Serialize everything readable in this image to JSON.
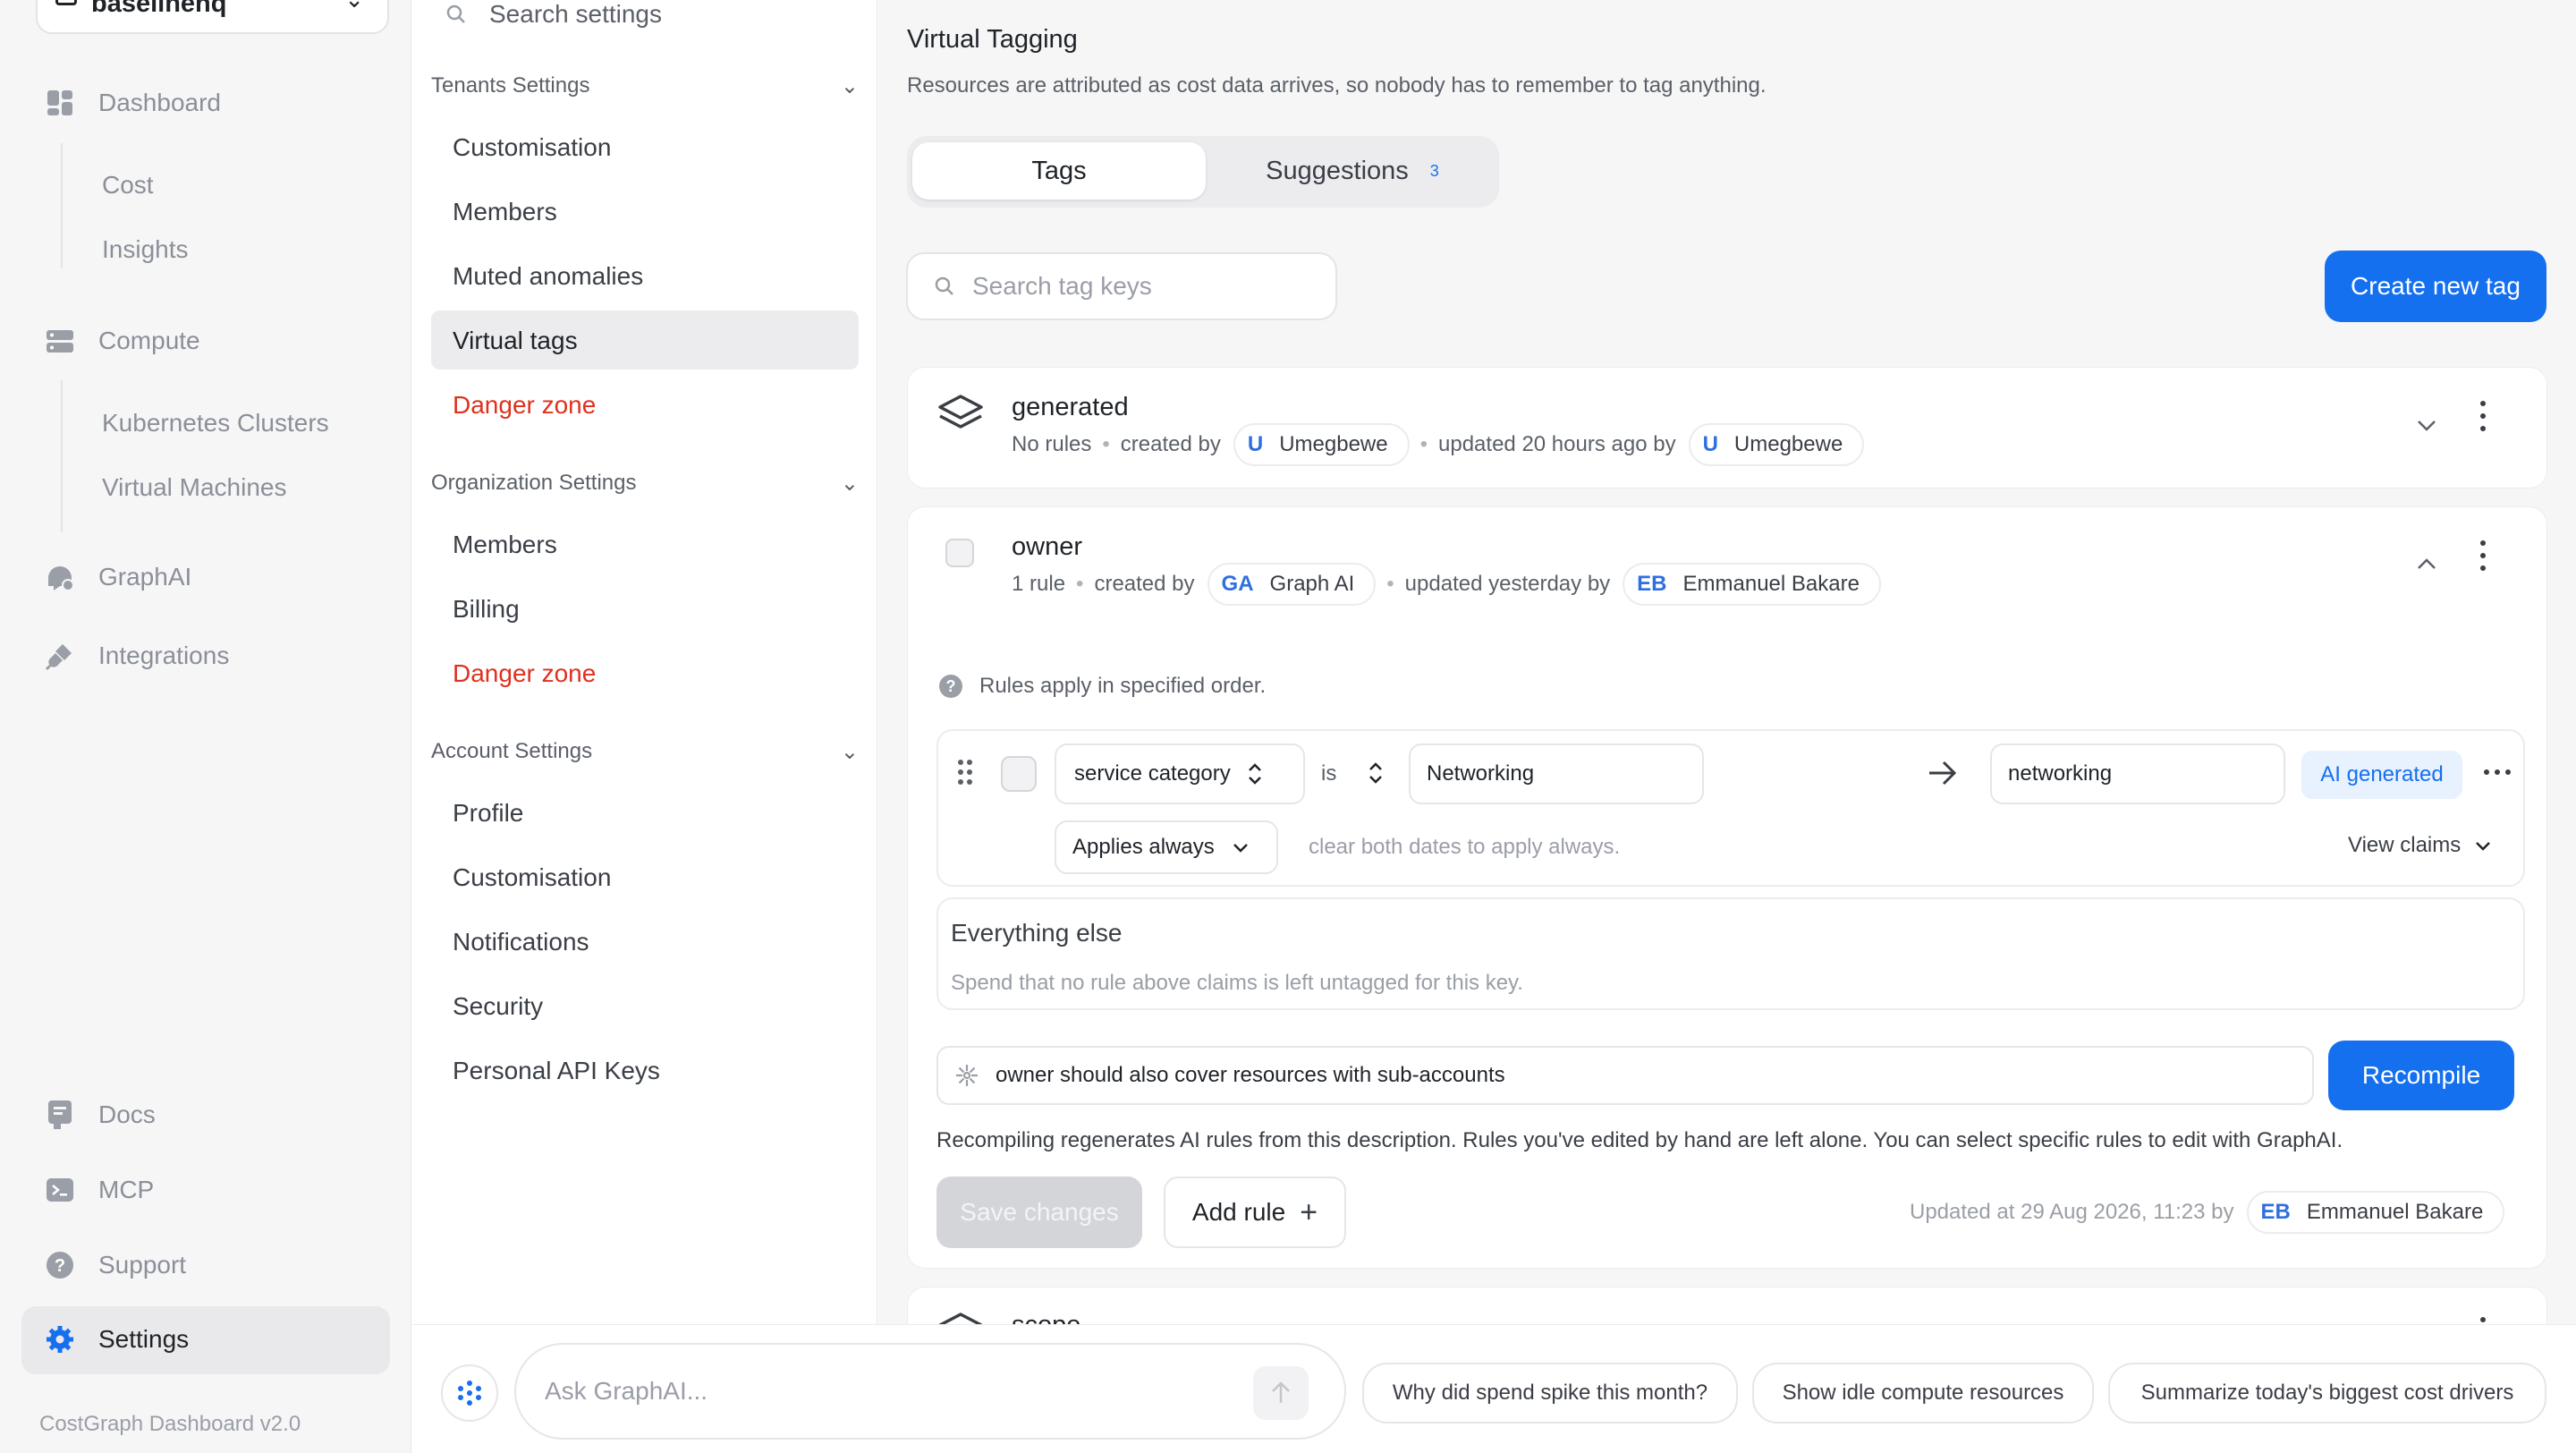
{
  "tenant": {
    "name": "baselinehq"
  },
  "nav": {
    "dashboard": "Dashboard",
    "cost": "Cost",
    "insights": "Insights",
    "compute": "Compute",
    "k8s": "Kubernetes Clusters",
    "vms": "Virtual Machines",
    "graphai": "GraphAI",
    "integrations": "Integrations",
    "docs": "Docs",
    "mcp": "MCP",
    "support": "Support",
    "settings": "Settings",
    "version": "CostGraph Dashboard v2.0"
  },
  "settings_nav": {
    "search_placeholder": "Search settings",
    "tenants_title": "Tenants Settings",
    "tenants_items": [
      "Customisation",
      "Members",
      "Muted anomalies",
      "Virtual tags",
      "Danger zone"
    ],
    "org_title": "Organization Settings",
    "org_items": [
      "Members",
      "Billing",
      "Danger zone"
    ],
    "account_title": "Account Settings",
    "account_items": [
      "Profile",
      "Customisation",
      "Notifications",
      "Security",
      "Personal API Keys"
    ]
  },
  "page": {
    "title": "Virtual Tagging",
    "subtitle": "Resources are attributed as cost data arrives, so nobody has to remember to tag anything.",
    "tab_tags": "Tags",
    "tab_suggestions": "Suggestions",
    "suggestions_count": "3",
    "search_placeholder": "Search tag keys",
    "create_button": "Create new tag"
  },
  "tag_generated": {
    "name": "generated",
    "rules": "No rules",
    "created_by_label": "created by",
    "creator_initials": "U",
    "creator_name": "Umegbewe",
    "updated_label": "updated 20 hours ago by",
    "updater_initials": "U",
    "updater_name": "Umegbewe"
  },
  "tag_owner": {
    "name": "owner",
    "rules": "1 rule",
    "created_by_label": "created by",
    "creator_initials": "GA",
    "creator_name": "Graph AI",
    "updated_label": "updated yesterday by",
    "updater_initials": "EB",
    "updater_name": "Emmanuel Bakare",
    "rules_note": "Rules apply in specified order.",
    "rule": {
      "field": "service category",
      "operator": "is",
      "value": "Networking",
      "target": "networking",
      "badge": "AI generated",
      "applies": "Applies always",
      "applies_hint": "clear both dates to apply always.",
      "view_claims": "View claims"
    },
    "else_title": "Everything else",
    "else_desc": "Spend that no rule above claims is left untagged for this key.",
    "prompt_value": "owner should also cover resources with sub-accounts",
    "recompile": "Recompile",
    "recompile_note": "Recompiling regenerates AI rules from this description. Rules you've edited by hand are left alone. You can select specific rules to edit with GraphAI.",
    "save": "Save changes",
    "add_rule": "Add rule",
    "updated_at": "Updated at 29 Aug 2026, 11:23 by",
    "updated_initials": "EB",
    "updated_name": "Emmanuel Bakare"
  },
  "tag_scope": {
    "name": "scope"
  },
  "assistant": {
    "placeholder": "Ask GraphAI...",
    "chips": [
      "Why did spend spike this month?",
      "Show idle compute resources",
      "Summarize today's biggest cost drivers"
    ]
  },
  "colors": {
    "accent": "#1570ef",
    "danger": "#e0301e",
    "sidebar_bg": "#f6f6f7"
  }
}
